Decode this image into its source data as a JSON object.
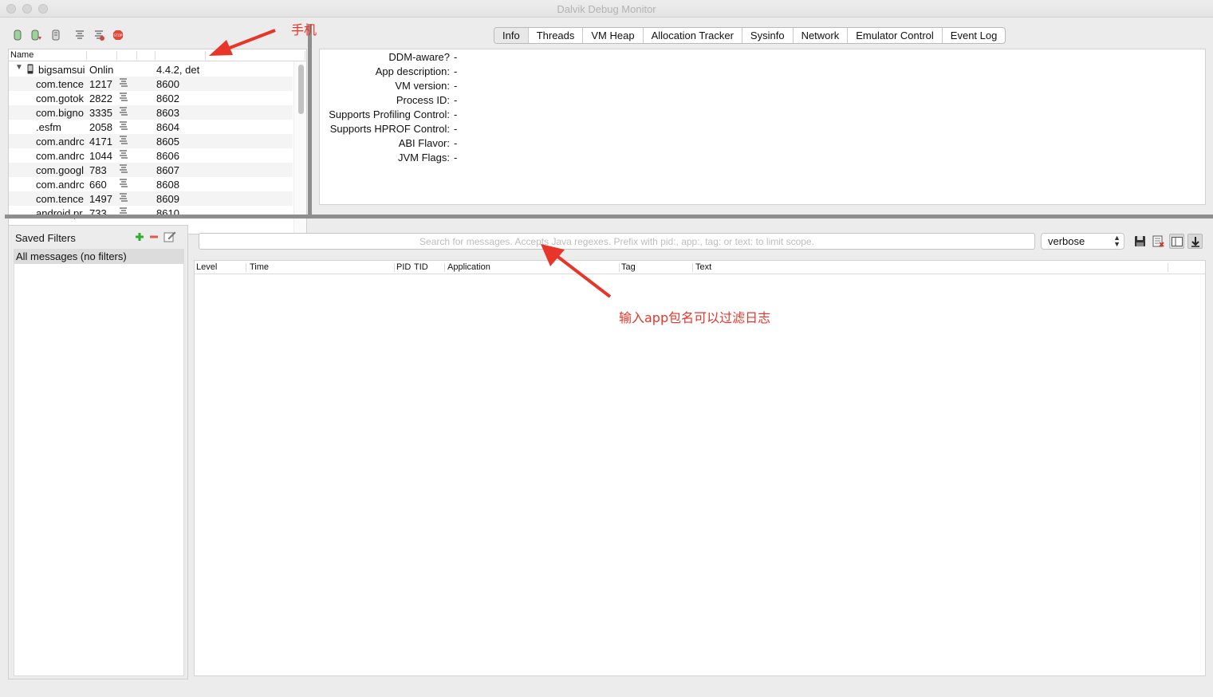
{
  "window": {
    "title": "Dalvik Debug Monitor"
  },
  "devices": {
    "header": {
      "name": "Name"
    },
    "device": {
      "name": "bigsamsui",
      "status": "Onlin",
      "version": "4.4.2, det"
    },
    "processes": [
      {
        "name": "com.tence",
        "pid": "1217",
        "port": "8600"
      },
      {
        "name": "com.gotok",
        "pid": "2822",
        "port": "8602"
      },
      {
        "name": "com.bigno",
        "pid": "3335",
        "port": "8603"
      },
      {
        "name": ".esfm",
        "pid": "2058",
        "port": "8604"
      },
      {
        "name": "com.andrc",
        "pid": "4171",
        "port": "8605"
      },
      {
        "name": "com.andrc",
        "pid": "1044",
        "port": "8606"
      },
      {
        "name": "com.googl",
        "pid": "783",
        "port": "8607"
      },
      {
        "name": "com.andrc",
        "pid": "660",
        "port": "8608"
      },
      {
        "name": "com.tence",
        "pid": "1497",
        "port": "8609"
      },
      {
        "name": "android.pr",
        "pid": "733",
        "port": "8610"
      }
    ]
  },
  "tabs": [
    "Info",
    "Threads",
    "VM Heap",
    "Allocation Tracker",
    "Sysinfo",
    "Network",
    "Emulator Control",
    "Event Log"
  ],
  "info": [
    {
      "label": "DDM-aware?",
      "value": "-"
    },
    {
      "label": "App description:",
      "value": "-"
    },
    {
      "label": "VM version:",
      "value": "-"
    },
    {
      "label": "Process ID:",
      "value": "-"
    },
    {
      "label": "Supports Profiling Control:",
      "value": "-"
    },
    {
      "label": "Supports HPROF Control:",
      "value": "-"
    },
    {
      "label": "ABI Flavor:",
      "value": "-"
    },
    {
      "label": "JVM Flags:",
      "value": "-"
    }
  ],
  "filters": {
    "title": "Saved Filters",
    "items": [
      "All messages (no filters)"
    ]
  },
  "logcat": {
    "search_placeholder": "Search for messages. Accepts Java regexes. Prefix with pid:, app:, tag: or text: to limit scope.",
    "level": "verbose",
    "columns": [
      "Level",
      "Time",
      "PID",
      "TID",
      "Application",
      "Tag",
      "Text"
    ]
  },
  "annotations": {
    "phone": "手机",
    "filter_hint": "输入app包名可以过滤日志"
  },
  "colors": {
    "annotation": "#e8352a",
    "splitter": "#8e8e8e",
    "add": "#2fae2f",
    "remove": "#e05a4c",
    "stop": "#e0493a"
  }
}
